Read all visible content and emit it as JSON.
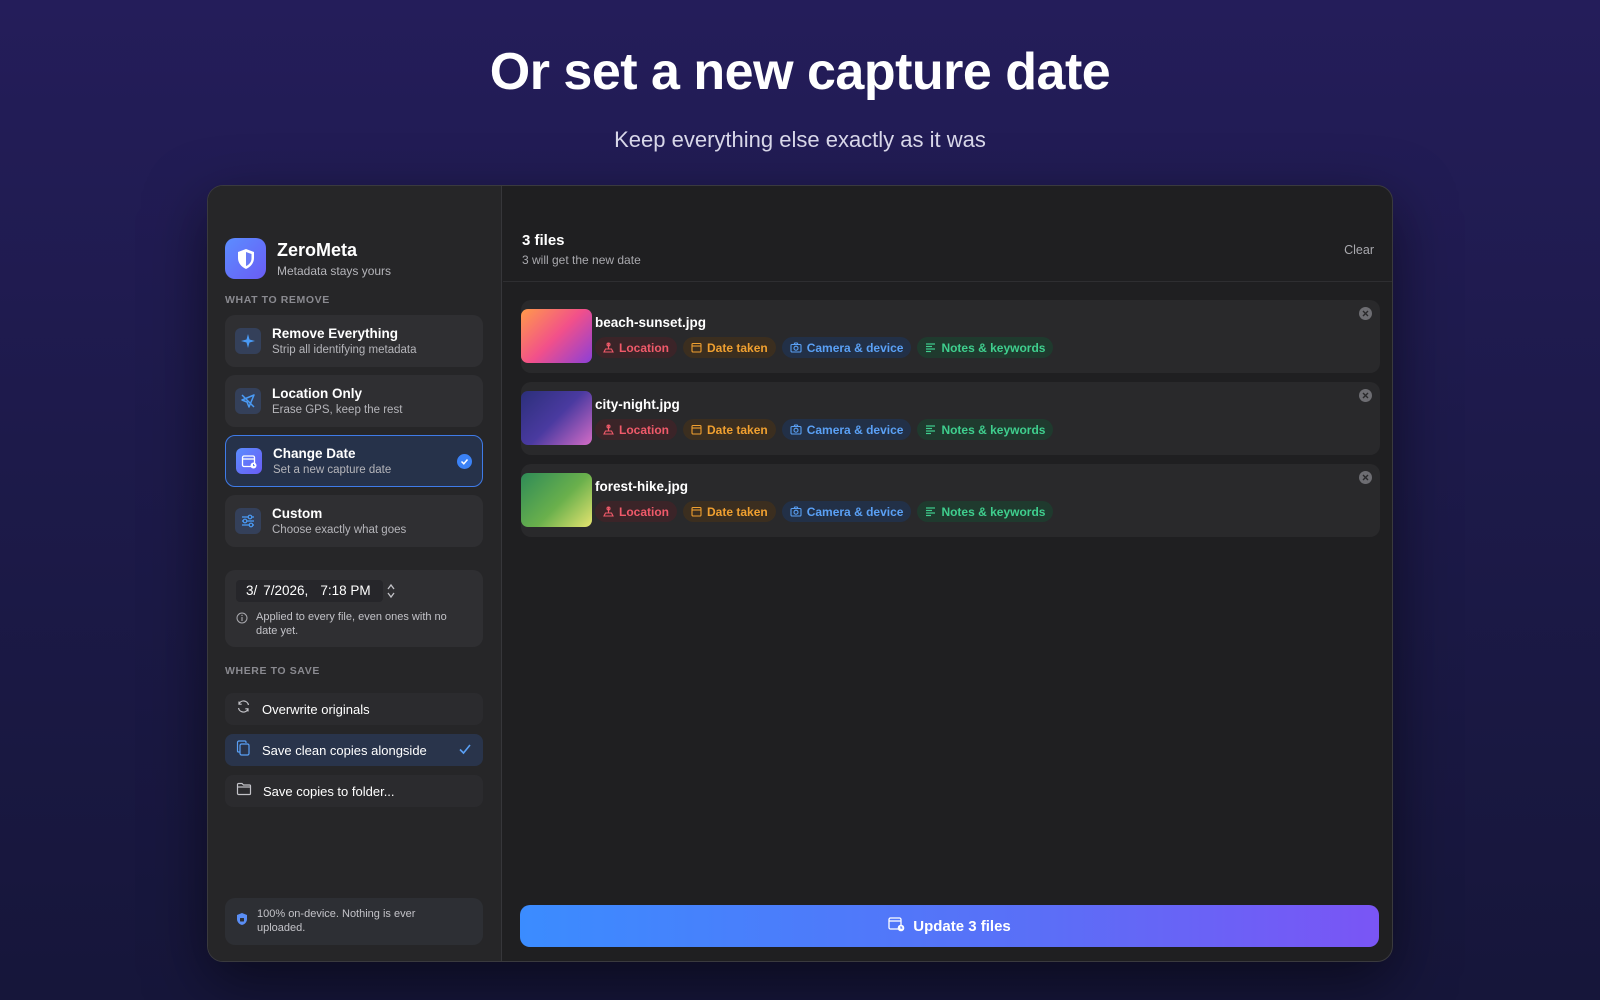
{
  "hero": {
    "title": "Or set a new capture date",
    "subtitle": "Keep everything else exactly as it was"
  },
  "app": {
    "name": "ZeroMeta",
    "tagline": "Metadata stays yours",
    "logo_icon": "shield-icon"
  },
  "sidebar": {
    "what_to_remove_label": "WHAT TO REMOVE",
    "modes": [
      {
        "title": "Remove Everything",
        "desc": "Strip all identifying metadata",
        "icon": "sparkle-icon",
        "selected": false
      },
      {
        "title": "Location Only",
        "desc": "Erase GPS, keep the rest",
        "icon": "location-off-icon",
        "selected": false
      },
      {
        "title": "Change Date",
        "desc": "Set a new capture date",
        "icon": "calendar-icon",
        "selected": true
      },
      {
        "title": "Custom",
        "desc": "Choose exactly what goes",
        "icon": "sliders-icon",
        "selected": false
      }
    ],
    "date_picker": {
      "month": "3/",
      "day_year": "7/2026,",
      "time": "7:18 PM",
      "note": "Applied to every file, even ones with no date yet."
    },
    "where_to_save_label": "WHERE TO SAVE",
    "save_options": [
      {
        "label": "Overwrite originals",
        "icon": "refresh-icon",
        "selected": false
      },
      {
        "label": "Save clean copies alongside",
        "icon": "copy-icon",
        "selected": true
      },
      {
        "label": "Save copies to folder...",
        "icon": "folder-icon",
        "selected": false
      }
    ],
    "privacy_note": "100% on-device. Nothing is ever uploaded."
  },
  "main": {
    "files_title": "3 files",
    "files_subtitle": "3 will get the new date",
    "clear_label": "Clear",
    "tag_labels": {
      "location": "Location",
      "date": "Date taken",
      "camera": "Camera & device",
      "notes": "Notes & keywords"
    },
    "files": [
      {
        "name": "beach-sunset.jpg"
      },
      {
        "name": "city-night.jpg"
      },
      {
        "name": "forest-hike.jpg"
      }
    ],
    "update_button": "Update 3 files"
  },
  "colors": {
    "accent": "#3b82f6",
    "location_tag": "#f05a6a",
    "date_tag": "#f0a030",
    "camera_tag": "#5aa0f5",
    "notes_tag": "#3fcf8e"
  }
}
